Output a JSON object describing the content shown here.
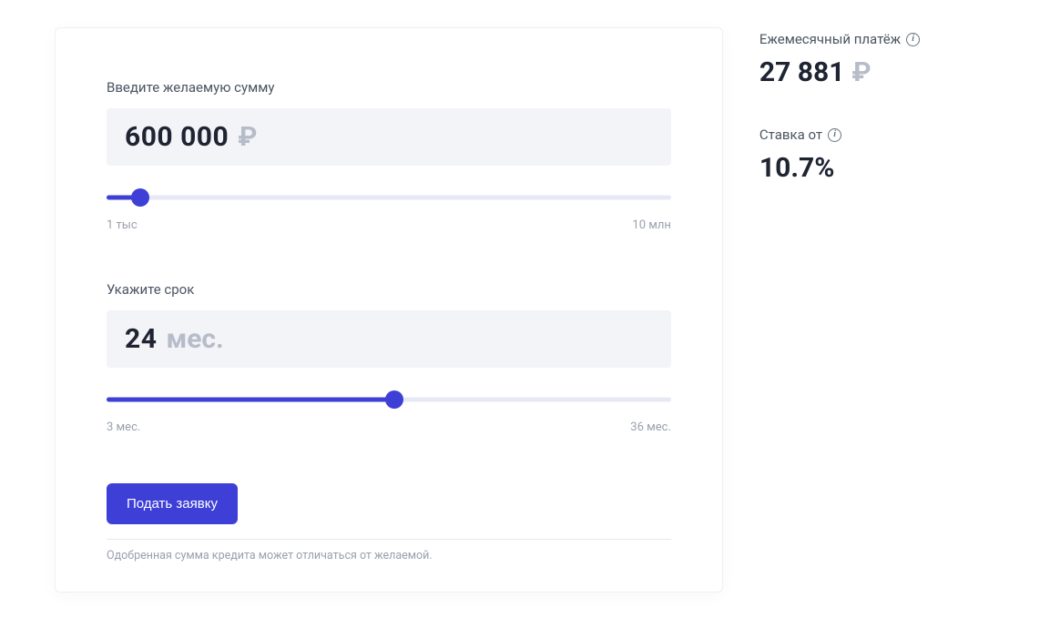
{
  "amount": {
    "label": "Введите желаемую сумму",
    "value": "600 000",
    "unit": "₽",
    "min_label": "1 тыс",
    "max_label": "10 млн",
    "fill_percent": 6
  },
  "term": {
    "label": "Укажите срок",
    "value": "24",
    "unit": "мес.",
    "min_label": "3 мес.",
    "max_label": "36 мес.",
    "fill_percent": 51
  },
  "submit_label": "Подать заявку",
  "disclaimer": "Одобренная сумма кредита может отличаться от желаемой.",
  "monthly_payment": {
    "label": "Ежемесячный платёж",
    "value": "27 881",
    "unit": "₽"
  },
  "rate": {
    "label": "Ставка от",
    "value": "10.7%"
  }
}
